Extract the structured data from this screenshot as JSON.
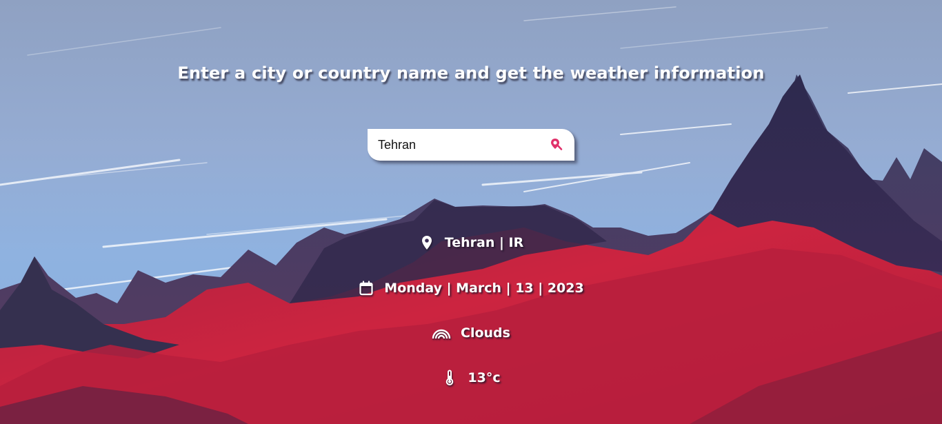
{
  "headline": "Enter a city or country name and get the weather information",
  "search": {
    "value": "Tehran",
    "icon": "location-search-icon"
  },
  "location": {
    "text": "Tehran | IR",
    "icon": "map-pin-icon"
  },
  "date": {
    "text": "Monday | March | 13 | 2023",
    "icon": "calendar-icon"
  },
  "weather": {
    "text": "Clouds",
    "icon": "rainbow-icon"
  },
  "temperature": {
    "text": "13°c",
    "icon": "thermometer-icon"
  },
  "colors": {
    "accent": "#e0316a",
    "mountain_red": "#c8213f",
    "mountain_dark": "#2e2a4f",
    "sky": "#92acd6"
  }
}
